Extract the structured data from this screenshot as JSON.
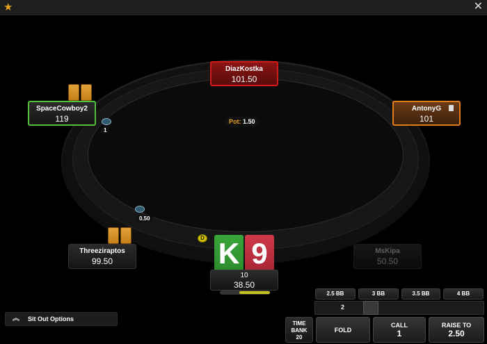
{
  "window": {
    "close_glyph": "✕",
    "star_glyph": "★"
  },
  "seats": {
    "top": {
      "name": "DiazKostka",
      "stack": "101.50"
    },
    "left": {
      "name": "SpaceCowboy2",
      "stack": "119",
      "bet": "1"
    },
    "right": {
      "name": "AntonyG",
      "stack": "101"
    },
    "bottom_left": {
      "name": "Threeziraptos",
      "stack": "99.50",
      "bet": "0.50"
    },
    "bottom_right": {
      "name": "MsKipa",
      "stack": "50.50"
    }
  },
  "pot": {
    "label": "Pot:",
    "value": "1.50"
  },
  "hero": {
    "name": "10",
    "stack": "38.50",
    "time_fraction": 0.6
  },
  "hole_cards": {
    "card1": "K",
    "card2": "9"
  },
  "dealer_glyph": "D",
  "sit_out": {
    "label": "Sit Out Options",
    "chevron": "︽"
  },
  "bet_presets": [
    "2.5 BB",
    "3 BB",
    "3.5 BB",
    "4 BB"
  ],
  "bet_amount": "2",
  "time_bank": {
    "line1": "TIME",
    "line2": "BANK",
    "value": "20"
  },
  "actions": {
    "fold": "FOLD",
    "call": {
      "label": "CALL",
      "value": "1"
    },
    "raise": {
      "label": "RAISE TO",
      "value": "2.50"
    }
  },
  "colors": {
    "accent": "#e9a21f",
    "active_seat": "#53c13b",
    "to_act": "#d31a1a",
    "note": "#e07d1a"
  }
}
